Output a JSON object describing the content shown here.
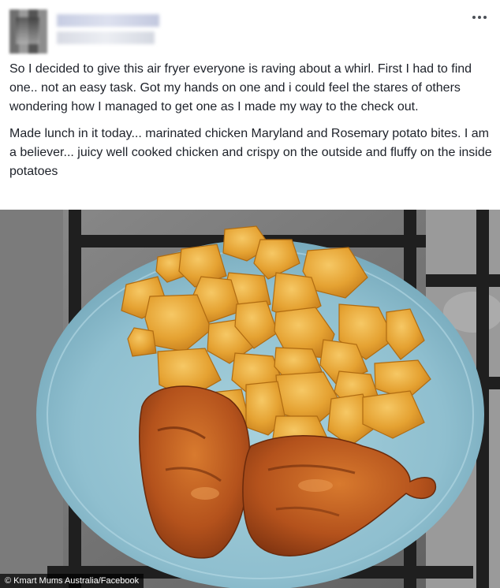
{
  "post": {
    "paragraphs": [
      "So I decided to give this air fryer everyone is raving about a whirl. First I had to find one.. not an easy task. Got my hands on one and i could feel the stares of others wondering how I managed to get one as I made my way to the check out.",
      "Made lunch in it today... marinated chicken Maryland and Rosemary potato bites. I am a believer... juicy well cooked chicken and crispy on the outside and fluffy on the inside potatoes"
    ],
    "more_icon": "more-options-icon"
  },
  "photo": {
    "credit": "© Kmart Mums Australia/Facebook",
    "colors": {
      "plate": "#9ec8d6",
      "potato": "#e8a93a",
      "chicken": "#b2531f",
      "stovetop": "#6a6a6a",
      "grate": "#2a2a2a"
    }
  }
}
